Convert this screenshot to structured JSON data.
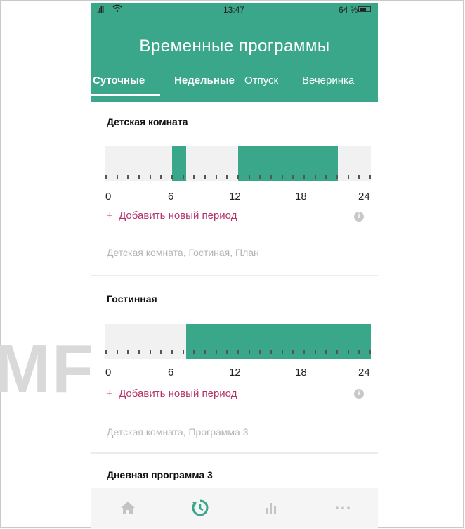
{
  "watermark": "MFORT",
  "status_bar": {
    "time": "13:47",
    "battery": "64 %",
    "battery_level": 0.64
  },
  "header": {
    "title": "Временные программы"
  },
  "tabs": [
    {
      "label": "Суточные",
      "active": true
    },
    {
      "label": "Недельные",
      "active": false
    },
    {
      "label": "Отпуск",
      "active": false
    },
    {
      "label": "Вечеринка",
      "active": false
    }
  ],
  "programs": [
    {
      "name": "Детская комната",
      "periods": [
        [
          6,
          7.3
        ],
        [
          12,
          21
        ]
      ],
      "axis": [
        "0",
        "6",
        "12",
        "18",
        "24"
      ],
      "add_label": "Добавить новый период",
      "add_icon": "+",
      "used_in": "Детская комната, Гостиная, План"
    },
    {
      "name": "Гостинная",
      "periods": [
        [
          7.3,
          24
        ]
      ],
      "axis": [
        "0",
        "6",
        "12",
        "18",
        "24"
      ],
      "add_label": "Добавить новый период",
      "add_icon": "+",
      "used_in": "Детская комната, Программа 3"
    },
    {
      "name": "Дневная программа 3"
    }
  ],
  "nav": [
    {
      "icon": "home-icon"
    },
    {
      "icon": "schedule-icon",
      "active": true
    },
    {
      "icon": "stats-icon"
    },
    {
      "icon": "more-icon"
    }
  ],
  "colors": {
    "accent": "#3aa68a",
    "link": "#b5336a",
    "muted": "#b4b4b4"
  }
}
